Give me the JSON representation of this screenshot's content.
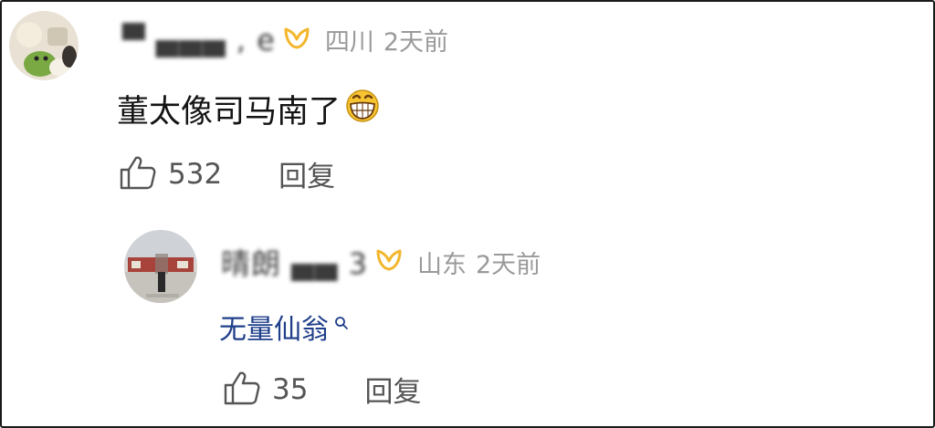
{
  "comments": [
    {
      "username": "▀ ▄▄▄ , e",
      "location": "四川",
      "time": "2天前",
      "text": "董太像司马南了",
      "like_count": "532",
      "reply_label": "回复",
      "emoji": "grinning-face-emoji"
    },
    {
      "username": "晴朗 ▄▄ 3",
      "location": "山东",
      "time": "2天前",
      "text": "无量仙翁",
      "like_count": "35",
      "reply_label": "回复",
      "link_icon": "search-icon"
    }
  ],
  "colors": {
    "meta": "#9a9a9a",
    "text": "#141414",
    "link": "#1f3f8a",
    "badge": "#f3b62c",
    "action": "#555555"
  }
}
